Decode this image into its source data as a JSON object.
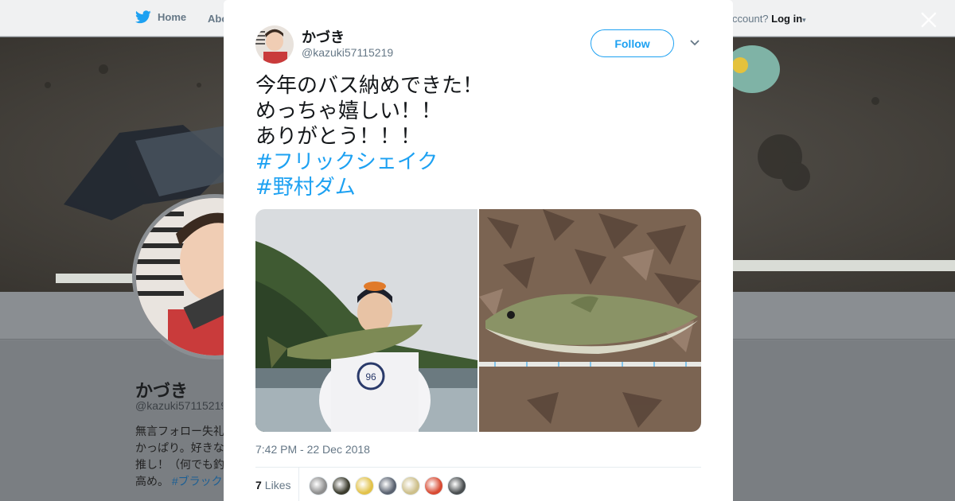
{
  "nav": {
    "home_label": "Home",
    "about_label": "Abo",
    "login_prefix": "ccount?",
    "login_label": "Log in"
  },
  "profile": {
    "name": "かづき",
    "handle": "@kazuki57115219",
    "bio_lines": [
      "無言フォロー失礼",
      "かっぱり。好きな",
      "推し！（何でも釣",
      "高め。"
    ],
    "bio_tag": "#ブラック"
  },
  "tweet": {
    "author_name": "かづき",
    "author_handle": "@kazuki57115219",
    "follow_label": "Follow",
    "text_lines": [
      "今年のバス納めできた！",
      "めっちゃ嬉しい！！",
      "ありがとう！！！"
    ],
    "hashtags": [
      "#フリックシェイク",
      "#野村ダム"
    ],
    "timestamp": "7:42 PM - 22 Dec 2018",
    "likes_count": "7",
    "likes_label": "Likes",
    "liker_count": 7
  },
  "colors": {
    "accent": "#1da1f2",
    "text": "#14171a",
    "muted": "#657786"
  },
  "icons": {
    "close": "close-icon",
    "caret": "chevron-down-icon",
    "brand": "twitter-bird-icon"
  }
}
